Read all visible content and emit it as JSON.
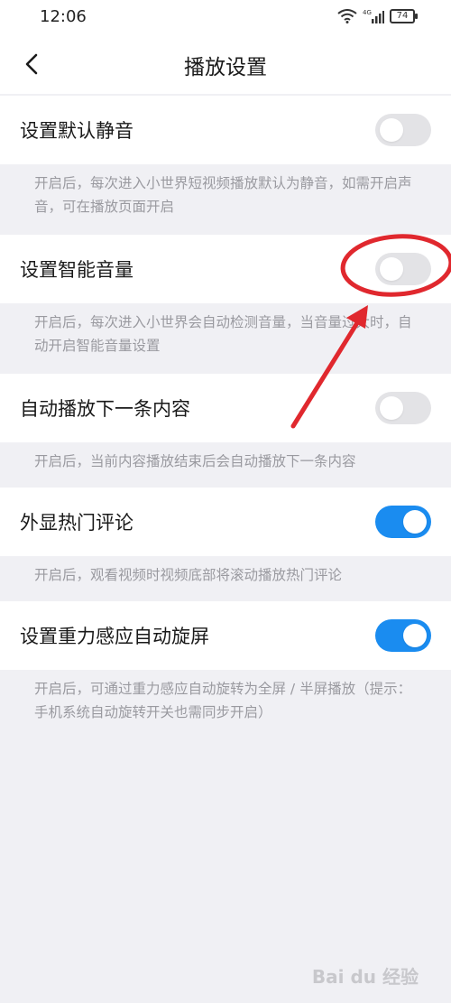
{
  "status_bar": {
    "time": "12:06",
    "network": "4G",
    "battery": "74"
  },
  "header": {
    "title": "播放设置"
  },
  "settings": [
    {
      "label": "设置默认静音",
      "enabled": false,
      "description": "开启后，每次进入小世界短视频播放默认为静音，如需开启声音，可在播放页面开启"
    },
    {
      "label": "设置智能音量",
      "enabled": false,
      "description": "开启后，每次进入小世界会自动检测音量，当音量过大时，自动开启智能音量设置"
    },
    {
      "label": "自动播放下一条内容",
      "enabled": false,
      "description": "开启后，当前内容播放结束后会自动播放下一条内容"
    },
    {
      "label": "外显热门评论",
      "enabled": true,
      "description": "开启后，观看视频时视频底部将滚动播放热门评论"
    },
    {
      "label": "设置重力感应自动旋屏",
      "enabled": true,
      "description": "开启后，可通过重力感应自动旋转为全屏 / 半屏播放（提示：手机系统自动旋转开关也需同步开启）"
    }
  ],
  "watermark": "Bai du 经验",
  "colors": {
    "toggle_on": "#1a8cf0",
    "toggle_off": "#e3e3e6",
    "annotation": "#e0282e"
  }
}
